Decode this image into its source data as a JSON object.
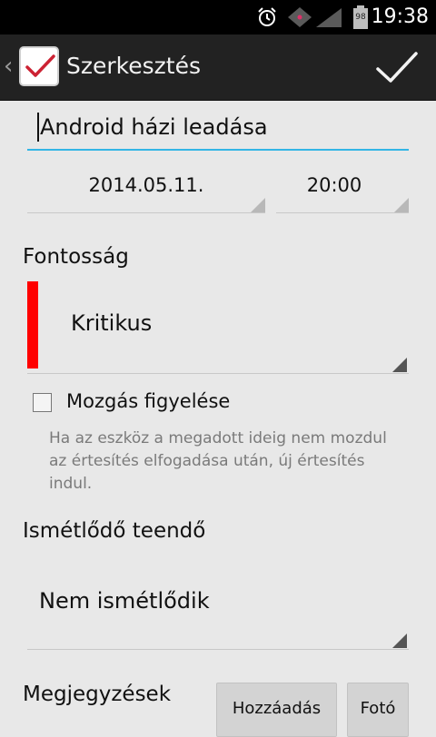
{
  "status_bar": {
    "time": "19:38",
    "battery_level": "98"
  },
  "action_bar": {
    "title": "Szerkesztés"
  },
  "form": {
    "title_value": "Android házi leadása",
    "date": "2014.05.11.",
    "time": "20:00",
    "priority_label": "Fontosság",
    "priority_value": "Kritikus",
    "priority_color": "#ff0000",
    "motion_label": "Mozgás figyelése",
    "motion_checked": false,
    "motion_help": "Ha az eszköz a megadott ideig nem mozdul az értesítés elfogadása után, új értesítés indul.",
    "repeat_label": "Ismétlődő teendő",
    "repeat_value": "Nem ismétlődik",
    "notes_label": "Megjegyzések",
    "add_button": "Hozzáadás",
    "photo_button": "Fotó"
  },
  "colors": {
    "accent": "#33b5e5",
    "action_bar": "#222222",
    "background": "#e8e8e8"
  }
}
